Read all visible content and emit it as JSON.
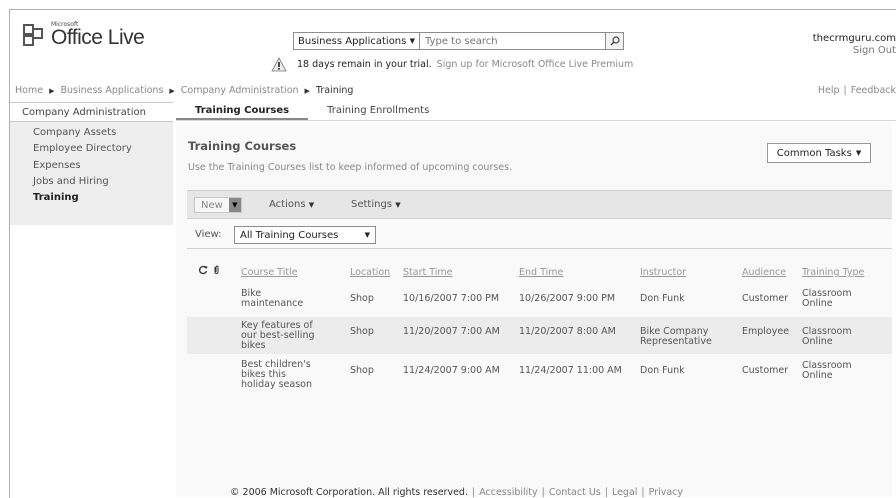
{
  "logo": {
    "small": "Microsoft",
    "main": "Office Live"
  },
  "search": {
    "scope": "Business Applications",
    "placeholder": "Type to search"
  },
  "user": {
    "name": "thecrmguru.com",
    "signout": "Sign Out"
  },
  "trial": {
    "message": "18 days remain in your trial.",
    "link": "Sign up for Microsoft Office Live Premium"
  },
  "breadcrumb": {
    "items": [
      "Home",
      "Business Applications",
      "Company Administration",
      "Training"
    ]
  },
  "toplinks": {
    "help": "Help",
    "feedback": "Feedback"
  },
  "leftnav": {
    "header": "Company Administration",
    "items": [
      "Company Assets",
      "Employee Directory",
      "Expenses",
      "Jobs and Hiring",
      "Training"
    ]
  },
  "tabs": [
    "Training Courses",
    "Training Enrollments"
  ],
  "page": {
    "title": "Training Courses",
    "description": "Use the Training Courses list to keep informed of upcoming courses.",
    "common_tasks": "Common Tasks"
  },
  "toolbar": {
    "new": "New",
    "actions": "Actions",
    "settings": "Settings"
  },
  "view": {
    "label": "View:",
    "selected": "All Training Courses"
  },
  "table": {
    "headers": [
      "Course Title",
      "Location",
      "Start Time",
      "End Time",
      "Instructor",
      "Audience",
      "Training Type"
    ],
    "rows": [
      {
        "title": [
          "Bike",
          "maintenance"
        ],
        "location": "Shop",
        "start": "10/16/2007 7:00 PM",
        "end": "10/26/2007 9:00 PM",
        "instructor": [
          "Don Funk"
        ],
        "audience": "Customer",
        "type": [
          "Classroom",
          "Online"
        ]
      },
      {
        "title": [
          "Key features of",
          "our best-selling",
          "bikes"
        ],
        "location": "Shop",
        "start": "11/20/2007 7:00 AM",
        "end": "11/20/2007 8:00 AM",
        "instructor": [
          "Bike Company",
          "Representative"
        ],
        "audience": "Employee",
        "type": [
          "Classroom",
          "Online"
        ]
      },
      {
        "title": [
          "Best children's",
          "bikes this",
          "holiday season"
        ],
        "location": "Shop",
        "start": "11/24/2007 9:00 AM",
        "end": "11/24/2007 11:00 AM",
        "instructor": [
          "Don Funk"
        ],
        "audience": "Customer",
        "type": [
          "Classroom",
          "Online"
        ]
      }
    ]
  },
  "footer": {
    "copyright": "© 2006 Microsoft Corporation. All rights reserved.",
    "links": [
      "Accessibility",
      "Contact Us",
      "Legal",
      "Privacy"
    ]
  }
}
